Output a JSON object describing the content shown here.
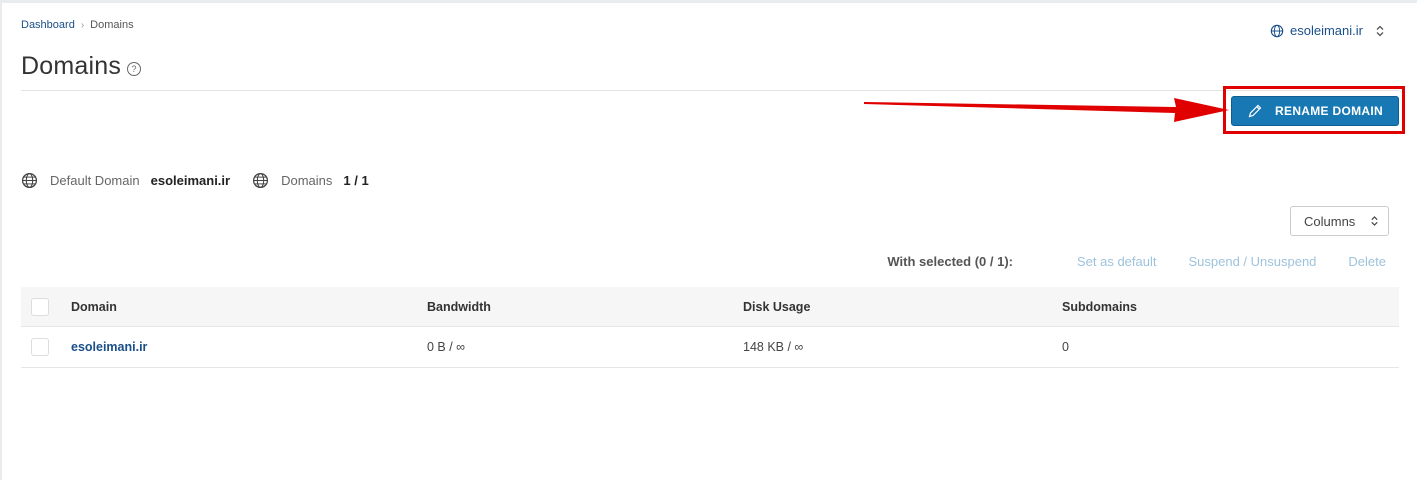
{
  "breadcrumb": {
    "root": "Dashboard",
    "separator": "›",
    "current": "Domains"
  },
  "domain_switcher": {
    "value": "esoleimani.ir",
    "icon": "globe-icon",
    "caret": "up-down-chevron-icon"
  },
  "page": {
    "title": "Domains",
    "help_icon": "?"
  },
  "actions": {
    "rename_label": "RENAME DOMAIN",
    "rename_icon": "pencil-icon"
  },
  "summary": {
    "default_domain_label": "Default Domain",
    "default_domain_value": "esoleimani.ir",
    "domains_label": "Domains",
    "domains_value": "1 / 1"
  },
  "columns_button": {
    "label": "Columns"
  },
  "bulk": {
    "label": "With selected (0 / 1):",
    "set_default": "Set as default",
    "suspend": "Suspend / Unsuspend",
    "delete": "Delete"
  },
  "table": {
    "headers": {
      "domain": "Domain",
      "bandwidth": "Bandwidth",
      "disk": "Disk Usage",
      "subdomains": "Subdomains"
    },
    "rows": [
      {
        "domain": "esoleimani.ir",
        "bandwidth": "0 B / ∞",
        "disk": "148 KB / ∞",
        "subdomains": "0"
      }
    ]
  },
  "colors": {
    "primary": "#1778b4",
    "highlight": "#e00000",
    "link": "#1a4f8a",
    "muted_action": "#9ec3dc"
  }
}
